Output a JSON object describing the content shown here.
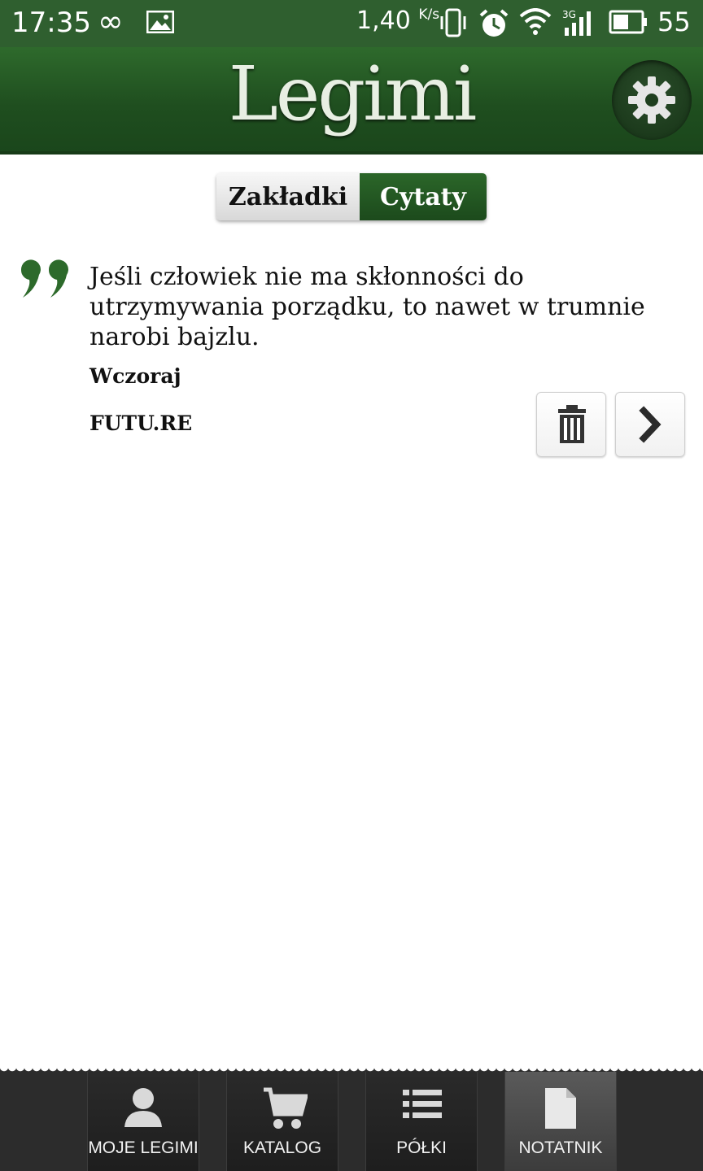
{
  "status_bar": {
    "time": "17:35",
    "network_speed": "1,40",
    "network_speed_unit": "K/s",
    "network_type": "3G",
    "battery_level": "55",
    "icons": [
      "infinity-icon",
      "image-icon",
      "vibrate-icon",
      "alarm-icon",
      "wifi-icon",
      "signal-icon",
      "battery-icon"
    ]
  },
  "header": {
    "logo_text": "Legimi",
    "settings_icon": "gear-icon"
  },
  "tabs": [
    {
      "label": "Zakładki",
      "active": false
    },
    {
      "label": "Cytaty",
      "active": true
    }
  ],
  "quotes": [
    {
      "text": "Jeśli człowiek nie ma skłonności do utrzymywania porządku, to nawet w trumnie narobi bajzlu.",
      "date": "Wczoraj",
      "book": "FUTU.RE"
    }
  ],
  "bottom_nav": [
    {
      "label": "MOJE LEGIMI",
      "icon": "user-icon",
      "active": false
    },
    {
      "label": "KATALOG",
      "icon": "cart-icon",
      "active": false
    },
    {
      "label": "PÓŁKI",
      "icon": "list-icon",
      "active": false
    },
    {
      "label": "NOTATNIK",
      "icon": "document-icon",
      "active": true
    }
  ],
  "colors": {
    "brand_green": "#1f4e1f",
    "status_bar": "#2f5f2f",
    "nav_background": "#2c2c2c"
  }
}
